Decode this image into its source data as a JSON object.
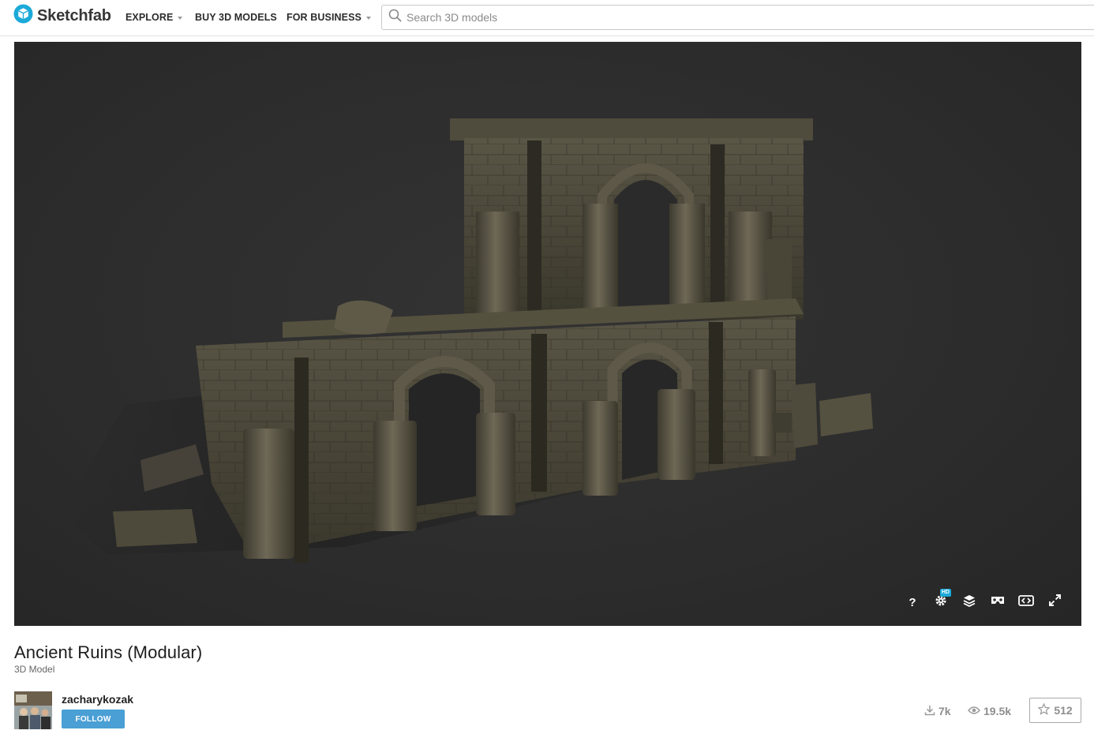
{
  "header": {
    "logo_text": "Sketchfab",
    "nav": [
      {
        "label": "EXPLORE",
        "has_dropdown": true
      },
      {
        "label": "BUY 3D MODELS",
        "has_dropdown": false
      },
      {
        "label": "FOR BUSINESS",
        "has_dropdown": true
      }
    ],
    "search": {
      "placeholder": "Search 3D models",
      "value": "",
      "icon": "search-icon"
    }
  },
  "viewer": {
    "controls": [
      {
        "icon": "help-icon",
        "label": "?"
      },
      {
        "icon": "settings-icon",
        "badge": "HD"
      },
      {
        "icon": "layers-icon"
      },
      {
        "icon": "vr-icon"
      },
      {
        "icon": "embed-icon"
      },
      {
        "icon": "fullscreen-icon"
      }
    ]
  },
  "model": {
    "title": "Ancient Ruins (Modular)",
    "subtitle": "3D Model"
  },
  "author": {
    "username": "zacharykozak",
    "follow_label": "FOLLOW"
  },
  "stats": {
    "downloads": "7k",
    "views": "19.5k",
    "likes": "512"
  },
  "colors": {
    "brand": "#1caad9",
    "follow_button": "#4a9fd5",
    "viewer_background": "#2e2e2e"
  }
}
